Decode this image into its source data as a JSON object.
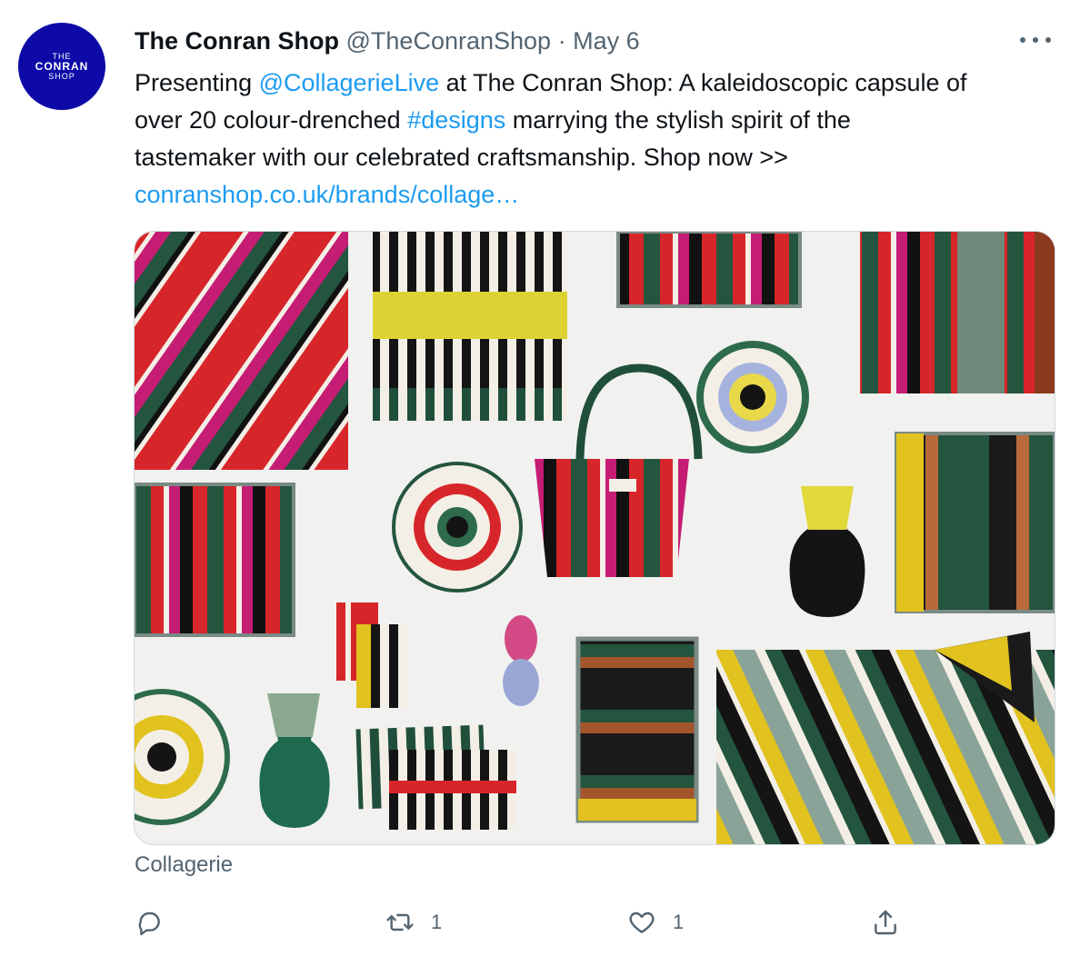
{
  "avatar": {
    "line1": "THE",
    "line2": "CONRAN",
    "line3": "SHOP"
  },
  "tweet": {
    "display_name": "The Conran Shop",
    "handle": "@TheConranShop",
    "separator": "·",
    "date": "May 6",
    "text": {
      "l1_a": "Presenting ",
      "l1_mention": "@CollagerieLive",
      "l1_b": " at The Conran Shop: A kaleidoscopic capsule of",
      "l2_a": "over 20 colour-drenched ",
      "l2_hashtag": "#designs",
      "l2_b": " marrying the stylish spirit of the",
      "l3": "tastemaker with our celebrated craftsmanship. Shop now >>",
      "l4_url": "conranshop.co.uk/brands/collage…"
    },
    "media_caption": "Collagerie"
  },
  "actions": {
    "reply_count": "",
    "retweet_count": "1",
    "like_count": "1"
  },
  "colors": {
    "link": "#1d9bf0",
    "secondary_text": "#536471",
    "avatar_bg": "#0d0aa8"
  },
  "icons": {
    "more": "more-dots-icon",
    "reply": "reply-icon",
    "retweet": "retweet-icon",
    "like": "heart-icon",
    "share": "share-icon"
  }
}
